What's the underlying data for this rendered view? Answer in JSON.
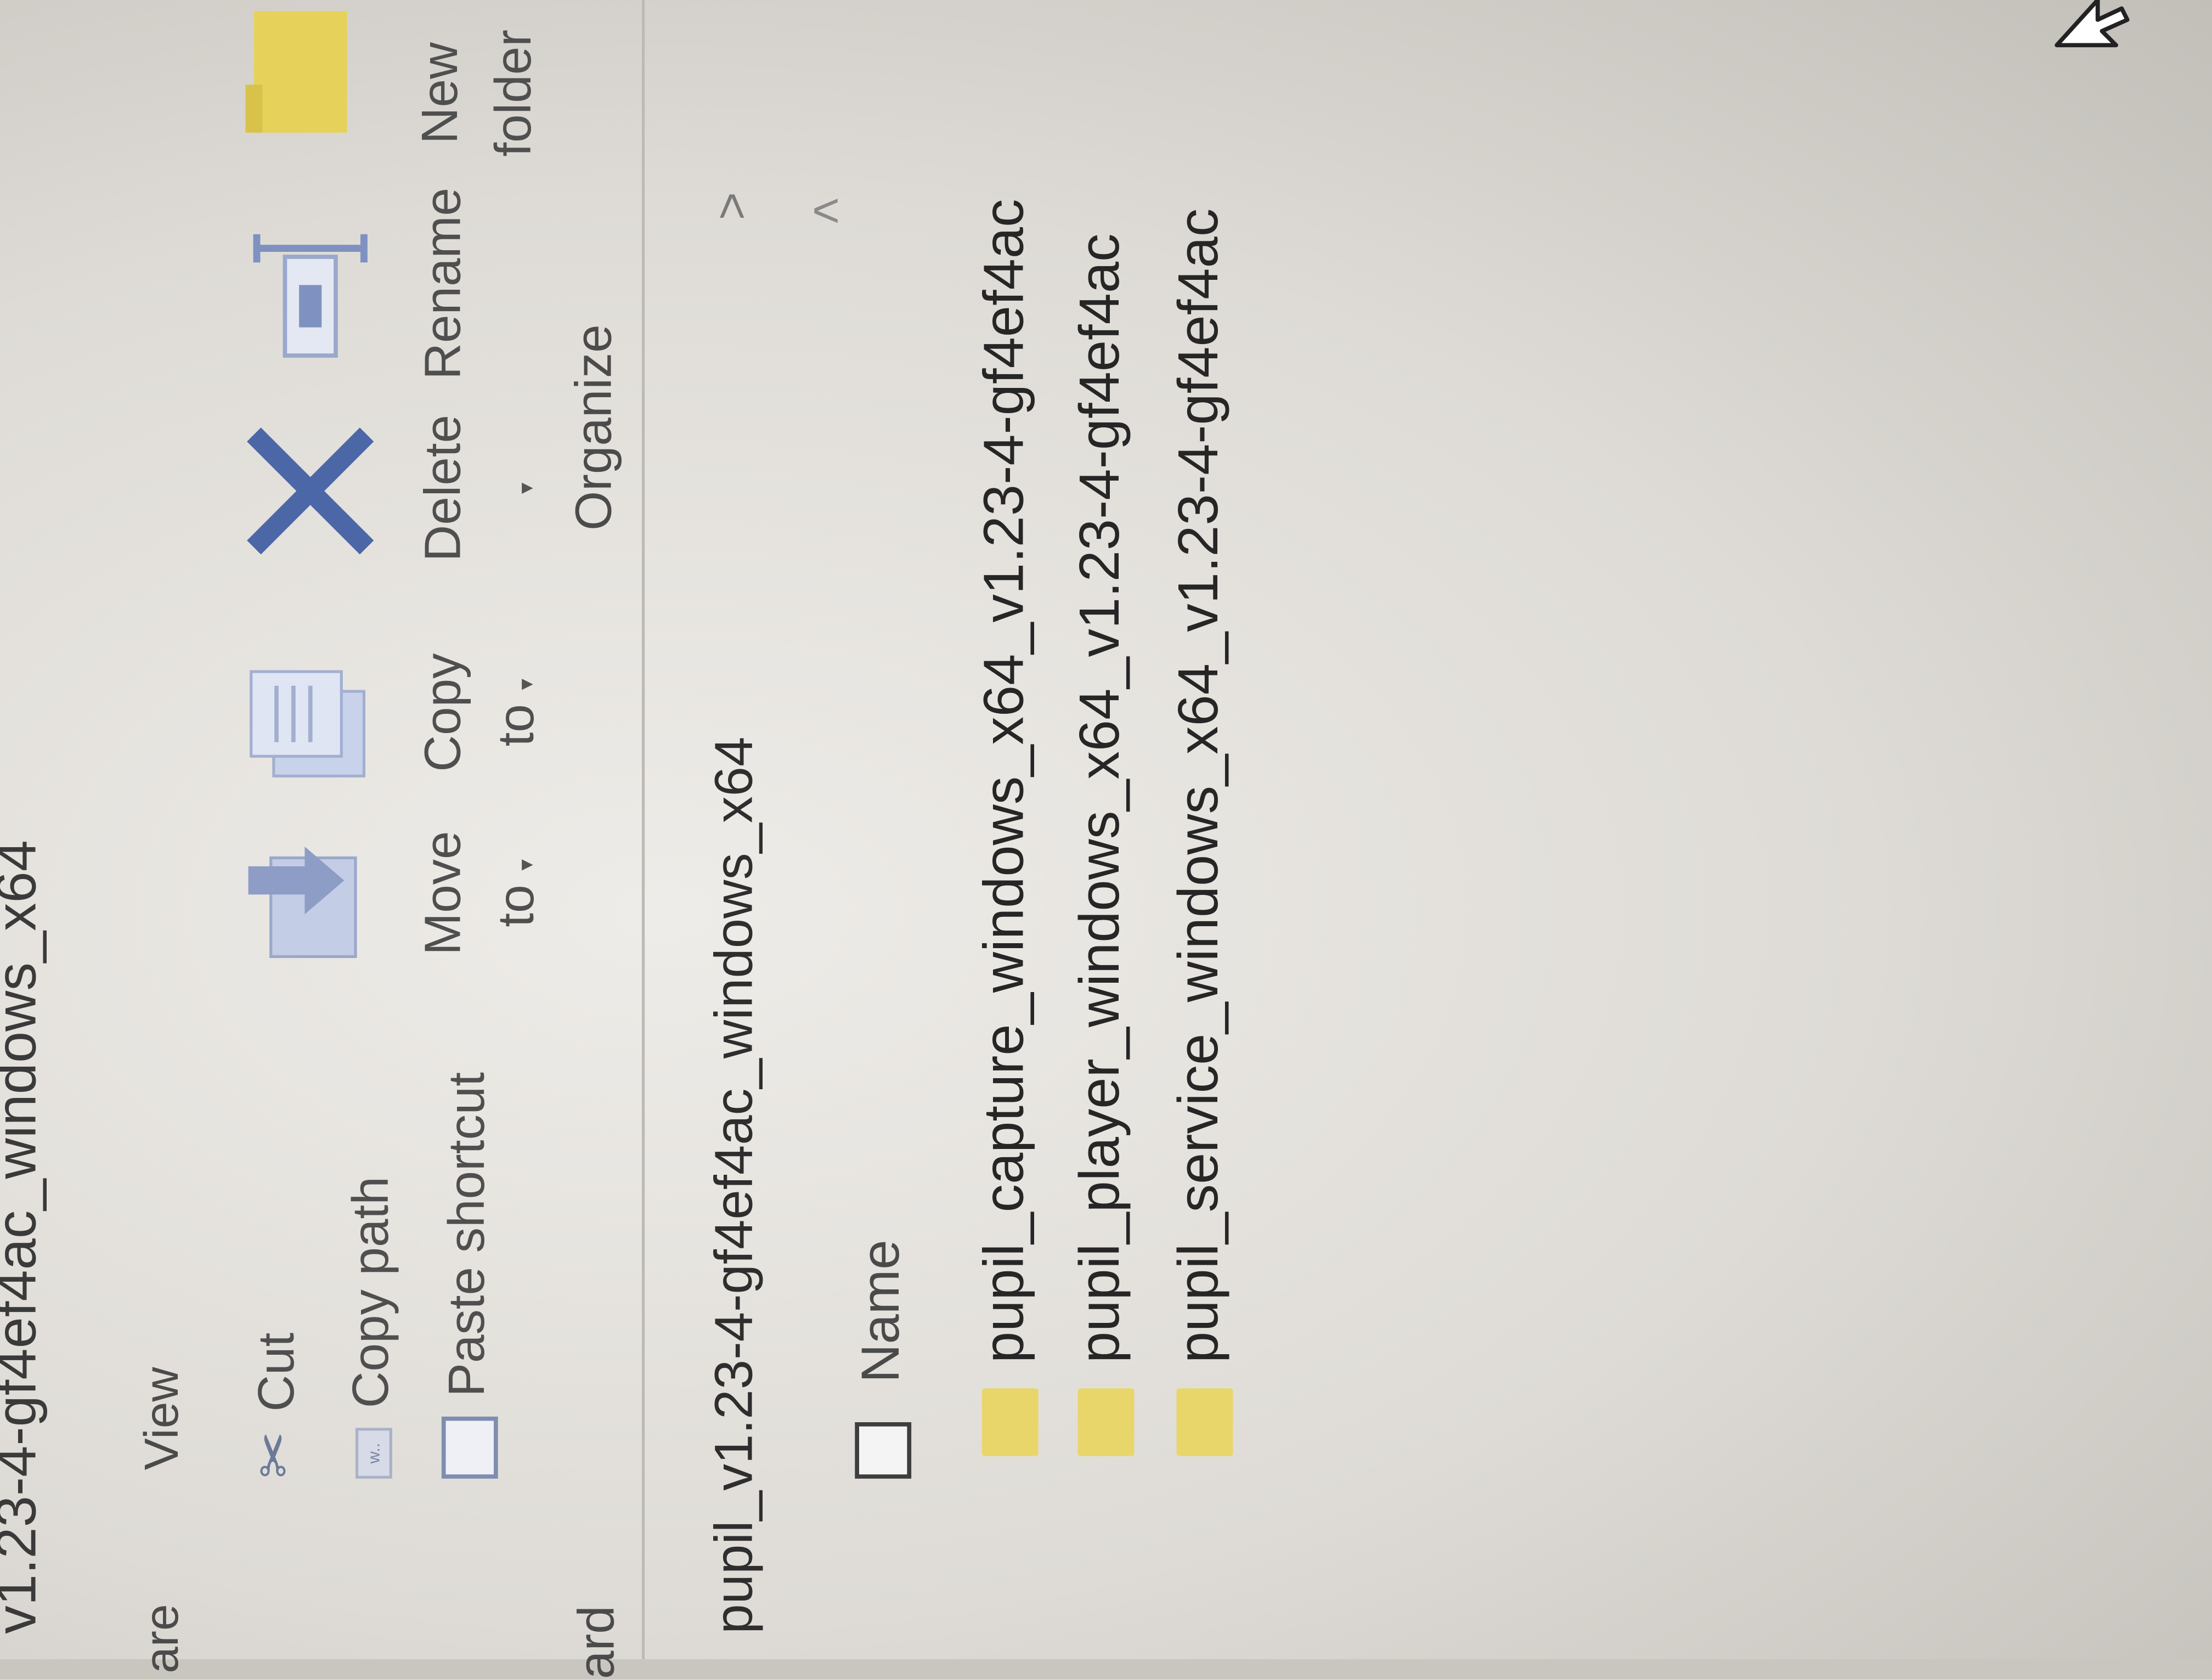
{
  "window": {
    "title": "v1.23-4-gf4ef4ac_windows_x64"
  },
  "tabs": {
    "share": "are",
    "view": "View"
  },
  "ribbon": {
    "cut": "Cut",
    "copy_path": "Copy path",
    "paste_shortcut": "Paste shortcut",
    "move_to": [
      "Move",
      "to"
    ],
    "copy_to": [
      "Copy",
      "to"
    ],
    "delete": "Delete",
    "rename": "Rename",
    "new_folder": [
      "New",
      "folder"
    ],
    "groups": {
      "clipboard": "ard",
      "organize": "Organize"
    }
  },
  "address_bar": {
    "path": "pupil_v1.23-4-gf4ef4ac_windows_x64"
  },
  "columns": {
    "name": "Name"
  },
  "files": [
    {
      "name": "pupil_capture_windows_x64_v1.23-4-gf4ef4ac",
      "icon": "folder-icon"
    },
    {
      "name": "pupil_player_windows_x64_v1.23-4-gf4ef4ac",
      "icon": "folder-icon"
    },
    {
      "name": "pupil_service_windows_x64_v1.23-4-gf4ef4ac",
      "icon": "folder-icon"
    }
  ],
  "colors": {
    "folder": "#e8d66a",
    "delete_icon": "#4b67a8",
    "background": "#eeece8"
  }
}
